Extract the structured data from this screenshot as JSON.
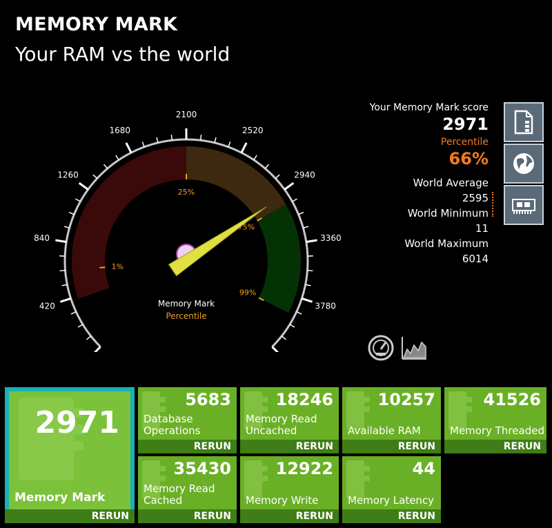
{
  "header": {
    "title": "MEMORY MARK",
    "subtitle": "Your RAM vs the world"
  },
  "gauge": {
    "ticks": [
      "0",
      "420",
      "840",
      "1260",
      "1680",
      "2100",
      "2520",
      "2940",
      "3360",
      "3780",
      "4200"
    ],
    "min": 0,
    "max": 4200,
    "value": 2971,
    "percentiles": [
      {
        "label": "1%",
        "value": 630
      },
      {
        "label": "25%",
        "value": 2100
      },
      {
        "label": "75%",
        "value": 3040
      },
      {
        "label": "99%",
        "value": 3920
      }
    ],
    "caption": "Memory Mark",
    "sub_caption": "Percentile",
    "colors": {
      "low": "#3a0a0a",
      "mid": "#3d2810",
      "high": "#053205",
      "needle": "#e0e040",
      "hub": "#f0d0f0",
      "accent": "#f0a020"
    }
  },
  "stats": {
    "score_label": "Your Memory Mark score",
    "score": "2971",
    "percentile_label": "Percentile",
    "percentile": "66%",
    "avg_label": "World Average",
    "avg": "2595",
    "min_label": "World Minimum",
    "min": "11",
    "max_label": "World Maximum",
    "max": "6014"
  },
  "side_buttons": [
    "document-chart-icon",
    "globe-icon",
    "memory-card-icon"
  ],
  "bottom_icons": [
    "speedometer-icon",
    "area-chart-icon"
  ],
  "tiles": {
    "main": {
      "value": "2971",
      "label": "Memory Mark",
      "rerun": "RERUN"
    },
    "items": [
      {
        "value": "5683",
        "label": "Database Operations",
        "rerun": "RERUN"
      },
      {
        "value": "18246",
        "label": "Memory Read Uncached",
        "rerun": "RERUN"
      },
      {
        "value": "10257",
        "label": "Available RAM",
        "rerun": "RERUN"
      },
      {
        "value": "41526",
        "label": "Memory Threaded",
        "rerun": "RERUN"
      },
      {
        "value": "35430",
        "label": "Memory Read Cached",
        "rerun": "RERUN"
      },
      {
        "value": "12922",
        "label": "Memory Write",
        "rerun": "RERUN"
      },
      {
        "value": "44",
        "label": "Memory Latency",
        "rerun": "RERUN"
      }
    ]
  }
}
